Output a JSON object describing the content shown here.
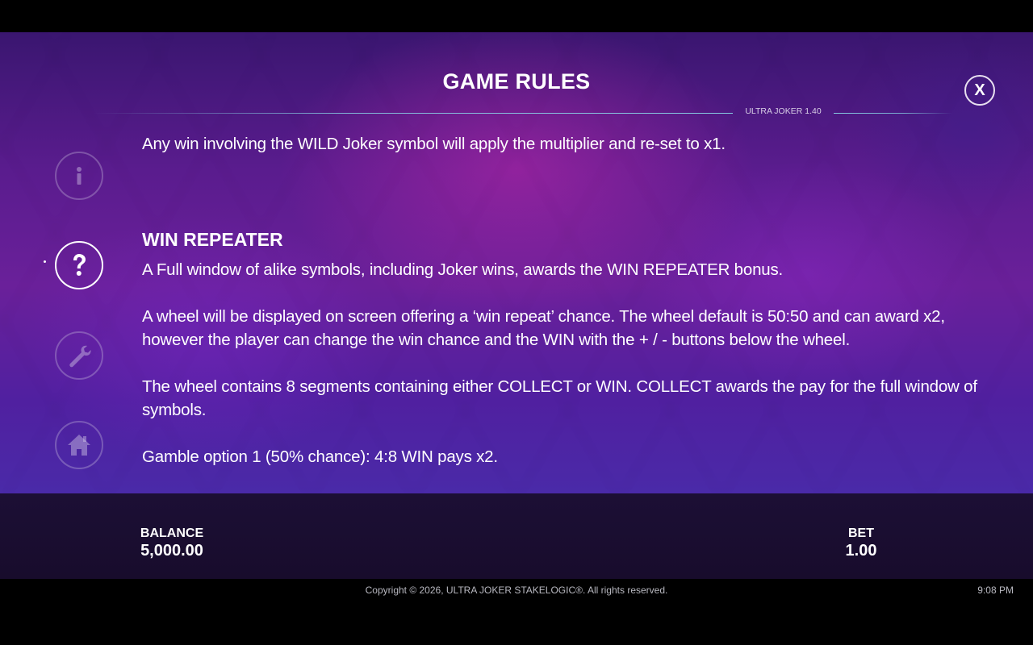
{
  "header": {
    "title": "GAME RULES",
    "version": "ULTRA JOKER 1.40",
    "close_label": "X"
  },
  "sidebar": {
    "items": [
      {
        "icon": "info-icon",
        "active": false
      },
      {
        "icon": "help-icon",
        "active": true
      },
      {
        "icon": "wrench-icon",
        "active": false
      },
      {
        "icon": "home-icon",
        "active": false
      }
    ]
  },
  "rules": {
    "intro": "Any win involving the WILD Joker symbol will apply the multiplier and re-set to x1.",
    "section_title": "WIN REPEATER",
    "p1": "A Full window of alike symbols, including Joker wins, awards the WIN REPEATER bonus.",
    "p2": "A wheel will be displayed on screen offering a ‘win repeat’ chance. The wheel default is 50:50 and can award x2, however the player can change the win chance and the WIN with the + / - buttons below the wheel.",
    "p3": "The wheel contains 8 segments containing either COLLECT or WIN. COLLECT awards the pay for the full window of symbols.",
    "p4": "Gamble option 1 (50% chance): 4:8 WIN pays x2."
  },
  "bar": {
    "balance_label": "BALANCE",
    "balance_value": "5,000.00",
    "bet_label": "BET",
    "bet_value": "1.00"
  },
  "footer": {
    "copyright": "Copyright © 2026, ULTRA JOKER STAKELOGIC®. All rights reserved.",
    "time": "9:08 PM"
  },
  "colors": {
    "accent_line": "#8cdceb",
    "bar_bg": "#1c0f35"
  }
}
